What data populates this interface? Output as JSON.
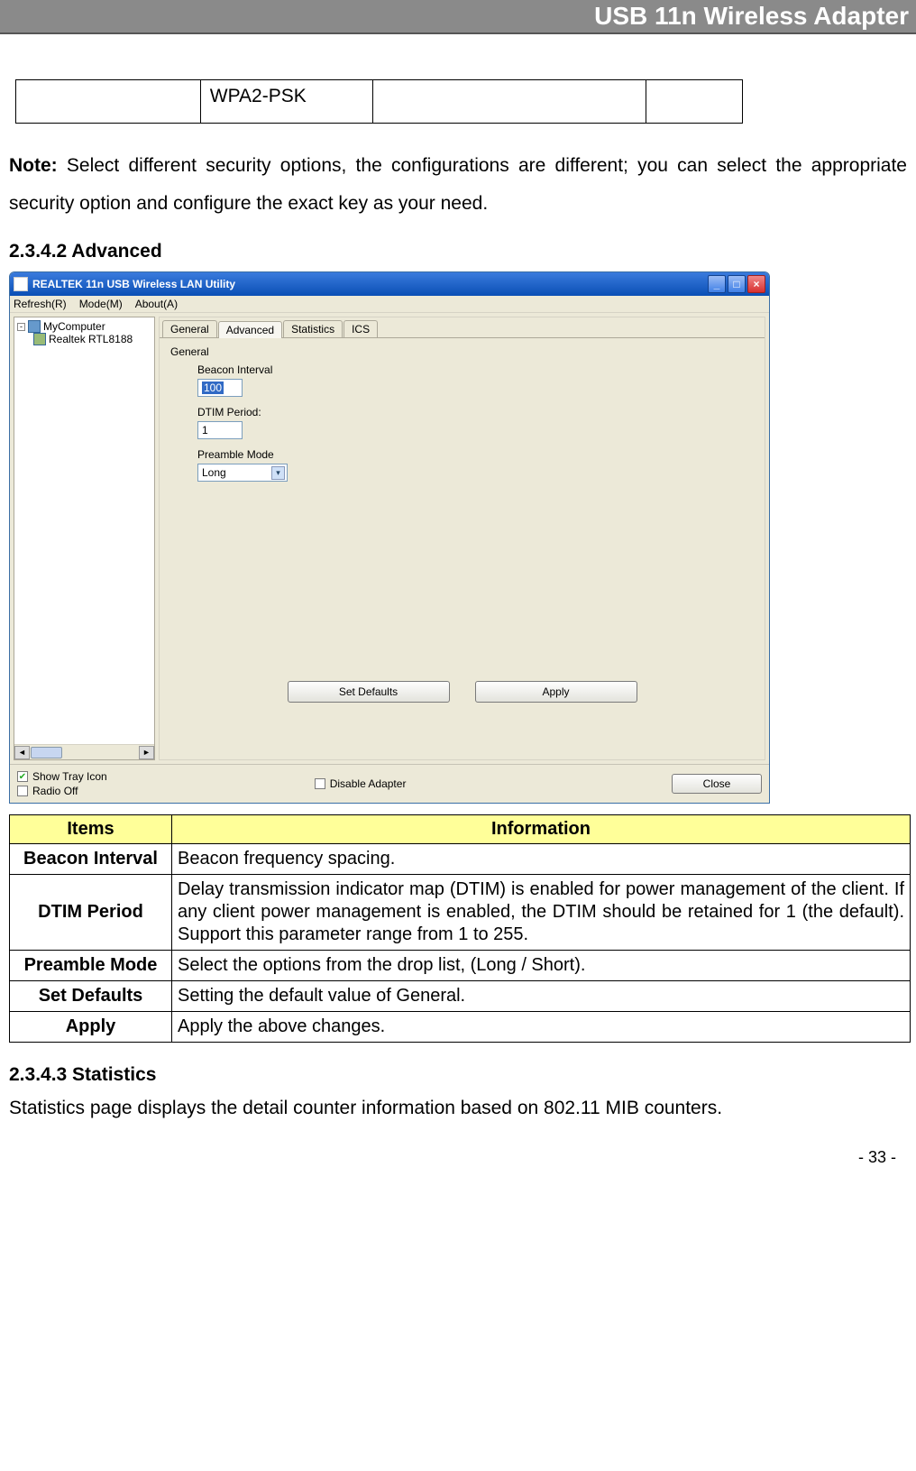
{
  "header": {
    "title": "USB 11n Wireless Adapter"
  },
  "wpa_row": {
    "c1": "",
    "c2": "WPA2-PSK",
    "c3": "",
    "c4": ""
  },
  "note": {
    "label": "Note:",
    "text": " Select different security options, the configurations are different; you can select the appropriate security option and configure the exact key as your need."
  },
  "sections": {
    "advanced": "2.3.4.2    Advanced",
    "statistics": "2.3.4.3    Statistics"
  },
  "app": {
    "title": "REALTEK 11n USB Wireless LAN Utility",
    "menu": {
      "refresh": "Refresh(R)",
      "mode": "Mode(M)",
      "about": "About(A)"
    },
    "tree": {
      "root": "MyComputer",
      "child": "Realtek RTL8188"
    },
    "tabs": {
      "general": "General",
      "advanced": "Advanced",
      "statistics": "Statistics",
      "ics": "ICS"
    },
    "group_label": "General",
    "fields": {
      "beacon_label": "Beacon Interval",
      "beacon_value": "100",
      "dtim_label": "DTIM Period:",
      "dtim_value": "1",
      "preamble_label": "Preamble Mode",
      "preamble_value": "Long"
    },
    "buttons": {
      "set_defaults": "Set Defaults",
      "apply": "Apply",
      "close": "Close"
    },
    "footer": {
      "show_tray": "Show Tray Icon",
      "radio_off": "Radio Off",
      "disable_adapter": "Disable Adapter"
    }
  },
  "info_table": {
    "headers": {
      "items": "Items",
      "info": "Information"
    },
    "rows": [
      {
        "item": "Beacon Interval",
        "info": "Beacon frequency spacing."
      },
      {
        "item": "DTIM Period",
        "info": "Delay transmission indicator map (DTIM) is enabled for power management of the client. If any client power management is enabled, the DTIM should be retained for 1 (the default). Support this parameter range from 1 to 255."
      },
      {
        "item": "Preamble Mode",
        "info": "Select the options from the drop list, (Long / Short)."
      },
      {
        "item": "Set Defaults",
        "info": "Setting the default value of General."
      },
      {
        "item": "Apply",
        "info": "Apply the above changes."
      }
    ]
  },
  "statistics_para": "Statistics page displays the detail counter information based on 802.11 MIB counters.",
  "page_num": "- 33 -"
}
